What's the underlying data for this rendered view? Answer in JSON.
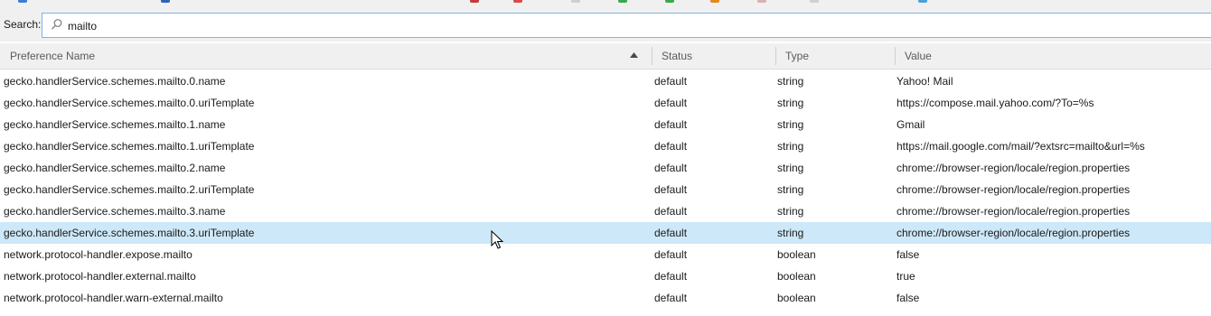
{
  "search": {
    "label": "Search:",
    "value": "mailto",
    "icon": "search-icon"
  },
  "columns": {
    "name": "Preference Name",
    "status": "Status",
    "type": "Type",
    "value": "Value"
  },
  "sort": {
    "column": "name",
    "direction": "ascending"
  },
  "colors": {
    "selected_row": "#cde8f8",
    "search_border": "#7eb4ea",
    "background": "#f0f0f0"
  },
  "rows": [
    {
      "name": "gecko.handlerService.schemes.mailto.0.name",
      "status": "default",
      "type": "string",
      "value": "Yahoo! Mail"
    },
    {
      "name": "gecko.handlerService.schemes.mailto.0.uriTemplate",
      "status": "default",
      "type": "string",
      "value": "https://compose.mail.yahoo.com/?To=%s"
    },
    {
      "name": "gecko.handlerService.schemes.mailto.1.name",
      "status": "default",
      "type": "string",
      "value": "Gmail"
    },
    {
      "name": "gecko.handlerService.schemes.mailto.1.uriTemplate",
      "status": "default",
      "type": "string",
      "value": "https://mail.google.com/mail/?extsrc=mailto&url=%s"
    },
    {
      "name": "gecko.handlerService.schemes.mailto.2.name",
      "status": "default",
      "type": "string",
      "value": "chrome://browser-region/locale/region.properties"
    },
    {
      "name": "gecko.handlerService.schemes.mailto.2.uriTemplate",
      "status": "default",
      "type": "string",
      "value": "chrome://browser-region/locale/region.properties"
    },
    {
      "name": "gecko.handlerService.schemes.mailto.3.name",
      "status": "default",
      "type": "string",
      "value": "chrome://browser-region/locale/region.properties"
    },
    {
      "name": "gecko.handlerService.schemes.mailto.3.uriTemplate",
      "status": "default",
      "type": "string",
      "value": "chrome://browser-region/locale/region.properties",
      "selected": true
    },
    {
      "name": "network.protocol-handler.expose.mailto",
      "status": "default",
      "type": "boolean",
      "value": "false"
    },
    {
      "name": "network.protocol-handler.external.mailto",
      "status": "default",
      "type": "boolean",
      "value": "true"
    },
    {
      "name": "network.protocol-handler.warn-external.mailto",
      "status": "default",
      "type": "boolean",
      "value": "false"
    }
  ]
}
